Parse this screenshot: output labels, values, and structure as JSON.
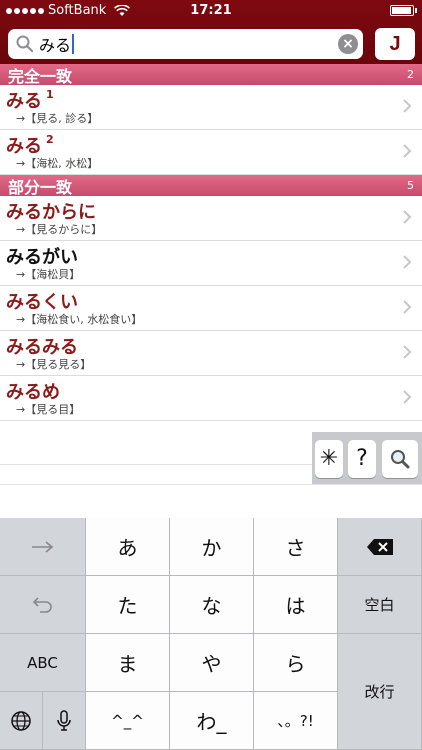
{
  "status": {
    "carrier": "SoftBank",
    "time": "17:21"
  },
  "search": {
    "query": "みる",
    "lang_button": "J"
  },
  "sections": [
    {
      "title": "完全一致",
      "count": "2"
    },
    {
      "title": "部分一致",
      "count": "5"
    }
  ],
  "exact": [
    {
      "head": "みる",
      "num": "1",
      "sub": "→【見る, 診る】"
    },
    {
      "head": "みる",
      "num": "2",
      "sub": "→【海松, 水松】"
    }
  ],
  "partial": [
    {
      "head": "みるからに",
      "sub": "→【見るからに】"
    },
    {
      "head": "みるがい",
      "sub": "→【海松貝】"
    },
    {
      "head": "みるくい",
      "sub": "→【海松食い, 水松食い】"
    },
    {
      "head": "みるみる",
      "sub": "→【見る見る】"
    },
    {
      "head": "みるめ",
      "sub": "→【見る目】"
    }
  ],
  "float_buttons": {
    "wildcard": "✳",
    "question": "?"
  },
  "keyboard": {
    "row1": [
      "あ",
      "か",
      "さ"
    ],
    "row2": [
      "た",
      "な",
      "は"
    ],
    "row3": [
      "ま",
      "や",
      "ら"
    ],
    "row4": [
      "^_^",
      "わ_",
      "、。?!"
    ],
    "abc": "ABC",
    "space": "空白",
    "enter": "改行"
  },
  "colors": {
    "header": "#7e0a10",
    "section": "#d85a7a",
    "headword": "#8b1a1a"
  }
}
